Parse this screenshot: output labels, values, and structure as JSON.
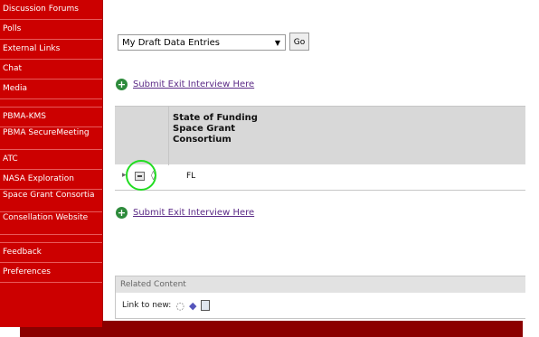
{
  "sidebar": {
    "items": [
      {
        "label": "Discussion Forums"
      },
      {
        "label": "Polls"
      },
      {
        "label": "External Links"
      },
      {
        "label": "Chat"
      },
      {
        "label": "Media"
      },
      {
        "label": "PBMA-KMS"
      },
      {
        "label": "PBMA SecureMeeting"
      },
      {
        "label": "ATC"
      },
      {
        "label": "NASA Exploration"
      },
      {
        "label": "Space Grant Consortia"
      },
      {
        "label": "Consellation Website"
      },
      {
        "label": "Feedback"
      },
      {
        "label": "Preferences"
      }
    ]
  },
  "view_selector": {
    "value": "My Draft Data Entries",
    "go_label": "Go"
  },
  "submit_link_top": "Submit Exit Interview Here",
  "submit_link_bottom": "Submit Exit Interview Here",
  "table": {
    "column_header": "State of Funding Space Grant Consortium",
    "rows": [
      {
        "value": "FL"
      }
    ]
  },
  "related_content": {
    "title": "Related Content",
    "link_to_new": "Link to new:"
  },
  "icons": [
    "chevron-icon",
    "edit-icon",
    "shield-icon",
    "plus-icon",
    "bubble-icon",
    "tag-icon",
    "document-icon"
  ],
  "colors": {
    "sidebar": "#cc0000",
    "link": "#5b2a86",
    "highlight": "#22dd22"
  }
}
